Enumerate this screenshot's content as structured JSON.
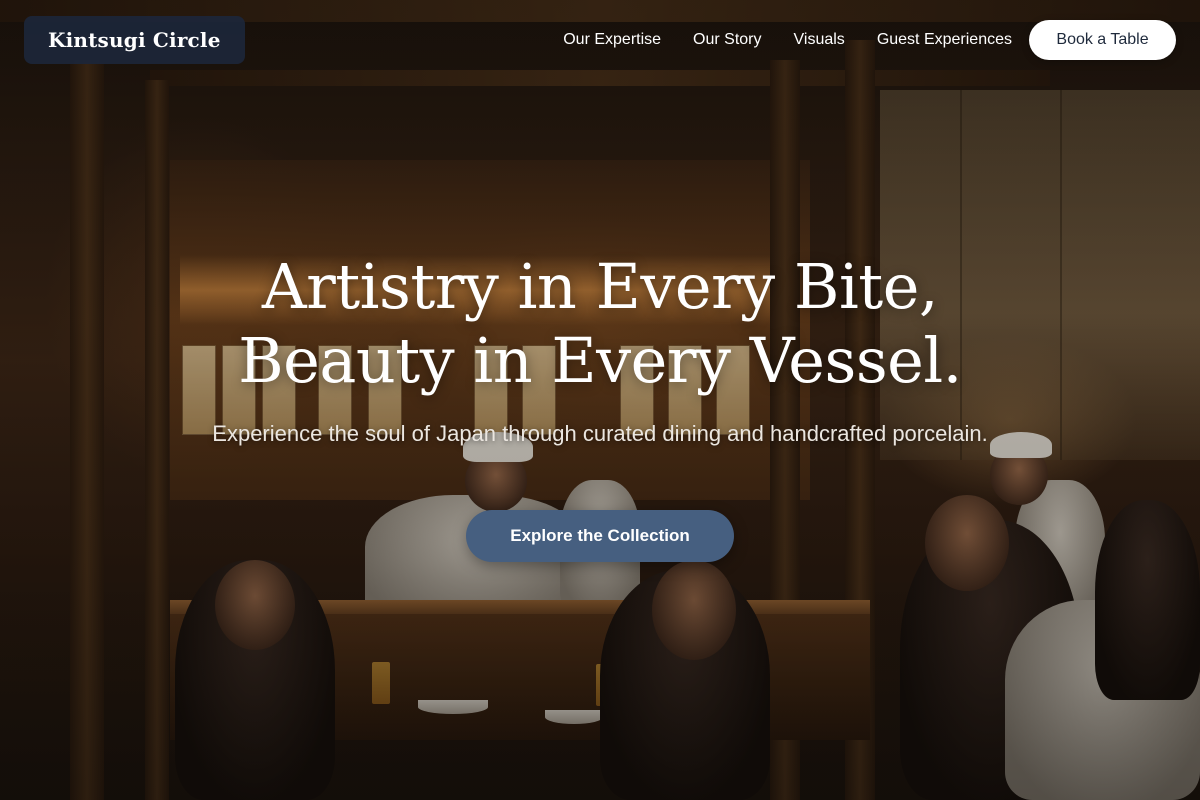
{
  "brand": {
    "name": "Kintsugi Circle"
  },
  "nav": {
    "links": [
      {
        "label": "Our Expertise"
      },
      {
        "label": "Our Story"
      },
      {
        "label": "Visuals"
      },
      {
        "label": "Guest Experiences"
      }
    ],
    "book_label": "Book a Table"
  },
  "hero": {
    "headline_line1": "Artistry in Every Bite,",
    "headline_line2": "Beauty in Every Vessel.",
    "subheadline": "Experience the soul of Japan through curated dining and handcrafted porcelain.",
    "cta_label": "Explore the Collection",
    "background_image": "dimly-lit-japanese-izakaya-interior-with-chefs-and-diners"
  },
  "colors": {
    "brand_badge_bg": "#1c263a",
    "cta_bg": "#465f80",
    "book_button_bg": "#ffffff",
    "book_button_text": "#1f2a3c",
    "text_primary": "#ffffff"
  }
}
